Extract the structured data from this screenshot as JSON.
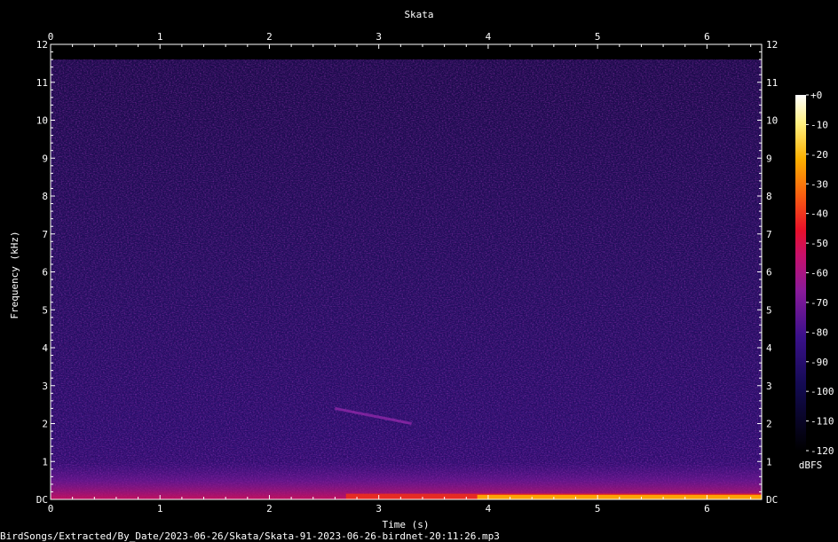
{
  "chart_data": {
    "type": "heatmap",
    "title": "Skata",
    "xlabel": "Time (s)",
    "ylabel": "Frequency (kHz)",
    "xlim": [
      0,
      6.5
    ],
    "ylim": [
      0,
      12
    ],
    "x_ticks": [
      "0",
      "1",
      "2",
      "3",
      "4",
      "5",
      "6"
    ],
    "y_ticks": [
      "DC",
      "1",
      "2",
      "3",
      "4",
      "5",
      "6",
      "7",
      "8",
      "9",
      "10",
      "11",
      "12"
    ],
    "colorbar": {
      "label": "dBFS",
      "range": [
        -120,
        0
      ],
      "ticks": [
        "+0",
        "-10",
        "-20",
        "-30",
        "-40",
        "-50",
        "-60",
        "-70",
        "-80",
        "-90",
        "-100",
        "-110",
        "-120"
      ]
    },
    "colors": {
      "low": "#000000",
      "mid_low": "#2a0a6e",
      "mid": "#7a1a9a",
      "mid_high": "#e0103a",
      "high": "#ffd000",
      "max": "#ffffff"
    },
    "content_max_khz": 11.6,
    "features": [
      {
        "type": "low_freq_band",
        "t_start": 0,
        "t_end": 6.5,
        "f_top_khz": 1.0,
        "level_db": -70
      },
      {
        "type": "hot_band",
        "t_start": 2.7,
        "t_end": 6.5,
        "f_top_khz": 0.15,
        "level_db": -30
      },
      {
        "type": "very_hot_band",
        "t_start": 3.9,
        "t_end": 6.5,
        "f_top_khz": 0.12,
        "level_db": -15
      },
      {
        "type": "chirp",
        "t_start": 2.6,
        "t_end": 3.3,
        "f_start_khz": 2.4,
        "f_end_khz": 2.0,
        "level_db": -80
      }
    ]
  },
  "footer": {
    "file_path": "BirdSongs/Extracted/By_Date/2023-06-26/Skata/Skata-91-2023-06-26-birdnet-20:11:26.mp3"
  }
}
